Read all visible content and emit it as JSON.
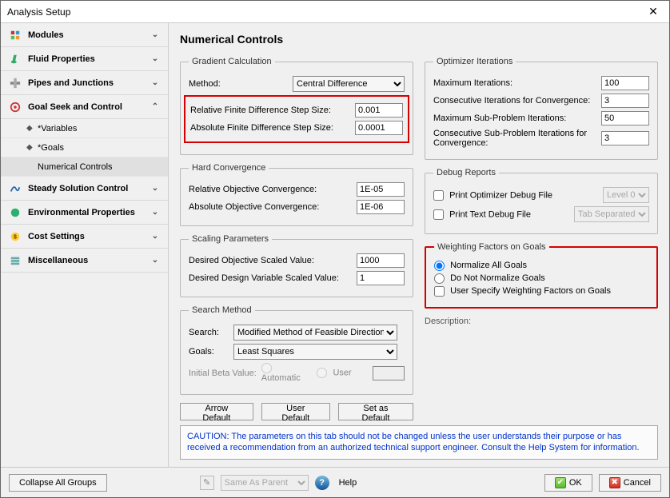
{
  "window": {
    "title": "Analysis Setup"
  },
  "sidebar": {
    "groups": [
      {
        "label": "Modules",
        "icon": "modules"
      },
      {
        "label": "Fluid Properties",
        "icon": "fluid"
      },
      {
        "label": "Pipes and Junctions",
        "icon": "pipes"
      },
      {
        "label": "Goal Seek and Control",
        "icon": "goal",
        "expanded": true,
        "children": [
          {
            "label": "*Variables"
          },
          {
            "label": "*Goals"
          },
          {
            "label": "Numerical Controls",
            "selected": true
          }
        ]
      },
      {
        "label": "Steady Solution Control",
        "icon": "steady"
      },
      {
        "label": "Environmental Properties",
        "icon": "env"
      },
      {
        "label": "Cost Settings",
        "icon": "cost"
      },
      {
        "label": "Miscellaneous",
        "icon": "misc"
      }
    ]
  },
  "main": {
    "title": "Numerical Controls",
    "gradient": {
      "legend": "Gradient Calculation",
      "method_label": "Method:",
      "method_value": "Central Difference",
      "rel_step_label": "Relative Finite Difference Step Size:",
      "rel_step_value": "0.001",
      "abs_step_label": "Absolute Finite Difference Step Size:",
      "abs_step_value": "0.0001"
    },
    "hard_conv": {
      "legend": "Hard Convergence",
      "rel_obj_label": "Relative Objective Convergence:",
      "rel_obj_value": "1E-05",
      "abs_obj_label": "Absolute Objective Convergence:",
      "abs_obj_value": "1E-06"
    },
    "scaling": {
      "legend": "Scaling Parameters",
      "obj_label": "Desired Objective Scaled Value:",
      "obj_value": "1000",
      "dv_label": "Desired Design Variable Scaled Value:",
      "dv_value": "1"
    },
    "search": {
      "legend": "Search Method",
      "search_label": "Search:",
      "search_value": "Modified Method of Feasible Direction",
      "goals_label": "Goals:",
      "goals_value": "Least Squares",
      "beta_label": "Initial Beta Value:",
      "beta_auto": "Automatic",
      "beta_user": "User"
    },
    "optimizer": {
      "legend": "Optimizer Iterations",
      "max_iter_label": "Maximum Iterations:",
      "max_iter_value": "100",
      "consec_conv_label": "Consecutive Iterations for Convergence:",
      "consec_conv_value": "3",
      "max_sub_label": "Maximum Sub-Problem Iterations:",
      "max_sub_value": "50",
      "consec_sub_label": "Consecutive Sub-Problem Iterations for Convergence:",
      "consec_sub_value": "3"
    },
    "debug": {
      "legend": "Debug Reports",
      "opt_label": "Print Optimizer Debug File",
      "opt_level": "Level 0",
      "txt_label": "Print Text Debug File",
      "txt_fmt": "Tab Separated"
    },
    "weighting": {
      "legend": "Weighting Factors on Goals",
      "normalize": "Normalize All Goals",
      "do_not": "Do Not Normalize Goals",
      "user_spec": "User Specify Weighting Factors on Goals"
    },
    "description_label": "Description:",
    "buttons": {
      "arrow_default": "Arrow Default",
      "user_default": "User Default",
      "set_default": "Set as Default"
    },
    "caution": "CAUTION: The parameters on this tab should not be changed unless the user understands their purpose or has received a recommendation from an authorized technical support engineer. Consult the Help System for information."
  },
  "footer": {
    "collapse": "Collapse All Groups",
    "same_as_parent": "Same As Parent",
    "help": "Help",
    "ok": "OK",
    "cancel": "Cancel"
  }
}
